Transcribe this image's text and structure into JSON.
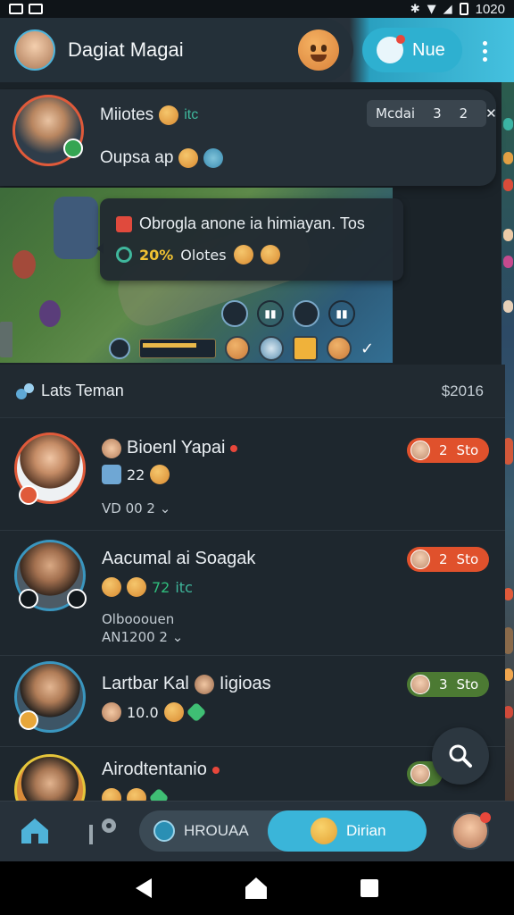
{
  "status_bar": {
    "time": "1020"
  },
  "app_bar": {
    "title": "Dagiat Magai",
    "news_label": "Nue"
  },
  "featured": {
    "name": "Miiotes",
    "name_tag": "itc",
    "subtitle": "Oupsa ap",
    "pill_label": "Mcdai",
    "pill_count": "3",
    "pill_right": "2"
  },
  "game_tooltip": {
    "line1": "Obrogla anone ia himiayan. Tos",
    "percent": "20%",
    "line2": "Olotes"
  },
  "section": {
    "title": "Lats Teman",
    "value": "$2016"
  },
  "friends": [
    {
      "name": "Bioenl Yapai",
      "count": "22",
      "meta": "VD  00  2",
      "badge_num": "2",
      "badge_label": "Sto",
      "badge_color": "#e0512c"
    },
    {
      "name": "Aacumal ai Soagak",
      "count": "72",
      "tag": "itc",
      "meta1": "Olbooouen",
      "meta2": "AN1200  2",
      "badge_num": "2",
      "badge_label": "Sto",
      "badge_color": "#e0512c"
    },
    {
      "name": "Lartbar Kal",
      "name2": "Iigioas",
      "count": "10.0",
      "badge_num": "3",
      "badge_label": "Sto",
      "badge_color": "#4c7a33"
    },
    {
      "name": "Airodtentanio"
    }
  ],
  "bottom_nav": {
    "seg_left": "HROUAA",
    "seg_right": "Dirian"
  },
  "icons": {
    "home": "home-icon",
    "map": "map-pin-icon",
    "search": "search-icon",
    "more": "more-vertical-icon"
  }
}
